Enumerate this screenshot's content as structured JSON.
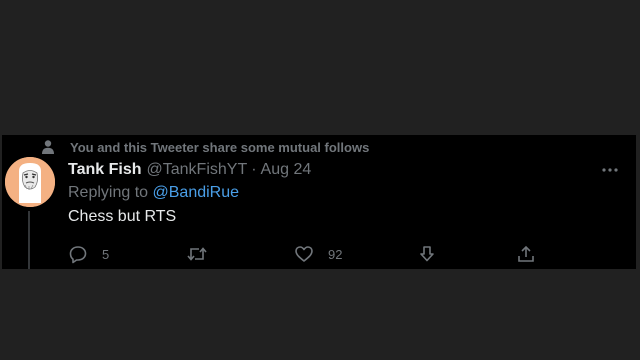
{
  "context": {
    "icon": "person-icon",
    "text": "You and this Tweeter share some mutual follows"
  },
  "tweet": {
    "author_name": "Tank Fish",
    "author_handle": "@TankFishYT",
    "separator": "·",
    "date": "Aug 24",
    "replying_prefix": "Replying to",
    "replying_to": "@BandiRue",
    "text": "Chess but RTS"
  },
  "actions": {
    "reply_count": "5",
    "retweet_count": "",
    "like_count": "92"
  },
  "colors": {
    "background": "#212121",
    "tweet_bg": "#000000",
    "text_primary": "#e7e9ea",
    "text_secondary": "#71767b",
    "link": "#4a9fe8",
    "avatar": "#f4b183"
  }
}
